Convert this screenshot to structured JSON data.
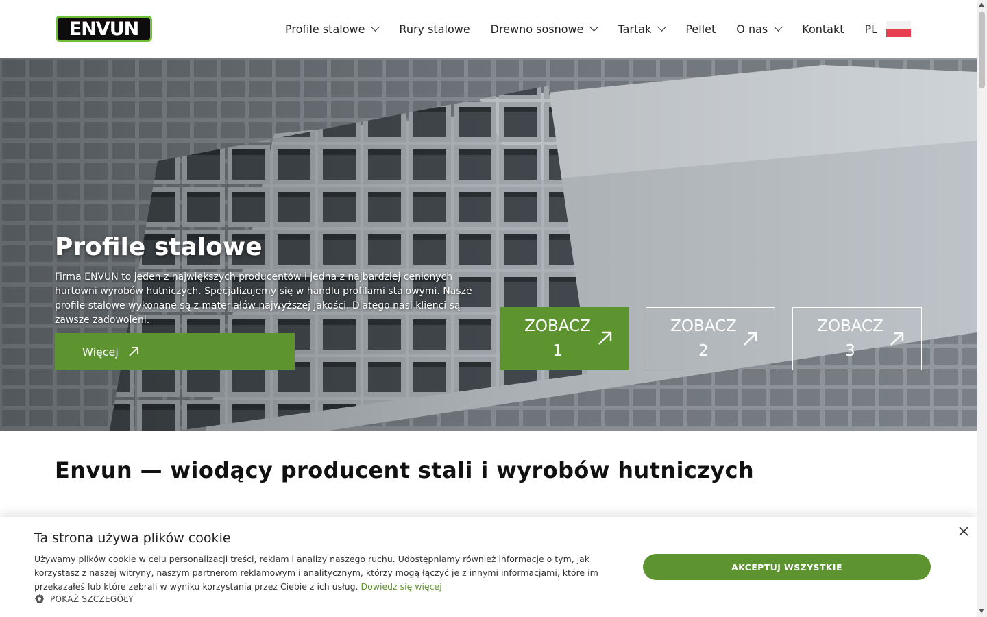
{
  "header": {
    "logo_text": "ENVUN",
    "nav": [
      {
        "label": "Profile stalowe",
        "has_dropdown": true
      },
      {
        "label": "Rury stalowe",
        "has_dropdown": false
      },
      {
        "label": "Drewno sosnowe",
        "has_dropdown": true
      },
      {
        "label": "Tartak",
        "has_dropdown": true
      },
      {
        "label": "Pellet",
        "has_dropdown": false
      },
      {
        "label": "O nas",
        "has_dropdown": true
      },
      {
        "label": "Kontakt",
        "has_dropdown": false
      },
      {
        "label": "PL",
        "has_dropdown": false
      }
    ],
    "flag_icon": "poland-flag-icon"
  },
  "hero": {
    "title": "Profile stalowe",
    "text": "Firma ENVUN to jeden z największych producentów i jedna z najbardziej cenionych hurtowni wyrobów hutniczych. Specjalizujemy się w handlu profilami stalowymi. Nasze profile stalowe wykonane są z materiałów najwyższej jakości. Dlatego nasi klienci są zawsze zadowoleni.",
    "more_button": "Więcej",
    "slides": [
      {
        "label": "ZOBACZ",
        "number": "1",
        "active": true
      },
      {
        "label": "ZOBACZ",
        "number": "2",
        "active": false
      },
      {
        "label": "ZOBACZ",
        "number": "3",
        "active": false
      }
    ]
  },
  "content": {
    "heading": "Envun — wiodący producent stali i wyrobów hutniczych"
  },
  "cookie": {
    "title": "Ta strona używa plików cookie",
    "text": "Używamy plików cookie w celu personalizacji treści, reklam i analizy naszego ruchu. Udostępniamy również informacje o tym, jak korzystasz z naszej witryny, naszym partnerom reklamowym i analitycznym, którzy mogą łączyć je z innymi informacjami, które im przekazałeś lub które zebrali w wyniku korzystania przez Ciebie z ich usług.",
    "link": "Dowiedz się więcej",
    "details": "POKAŻ SZCZEGÓŁY",
    "accept": "AKCEPTUJ WSZYSTKIE"
  },
  "colors": {
    "accent": "#5e9430",
    "logo_green": "#6fbf3b"
  }
}
